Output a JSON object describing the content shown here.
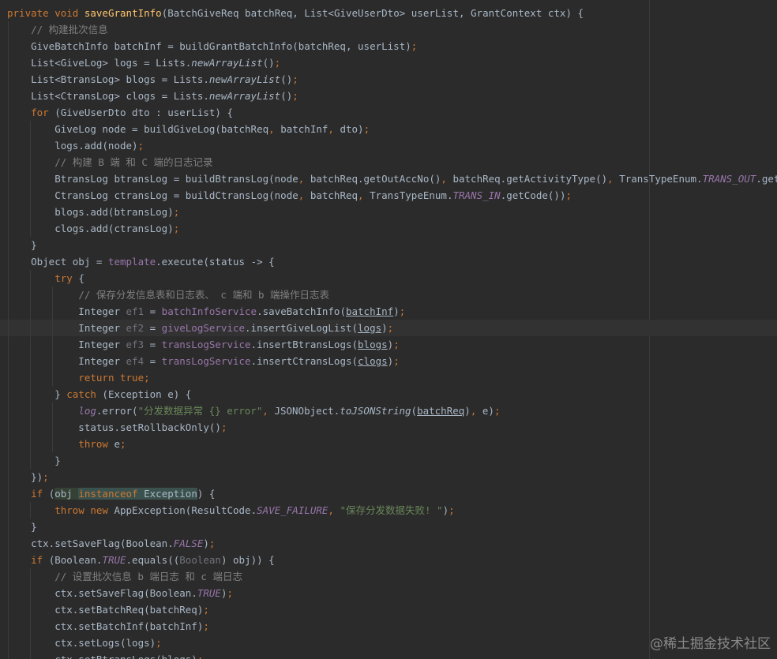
{
  "editor": {
    "language": "java",
    "theme": "darcula",
    "highlighted_line": 19,
    "watermark": "@稀土掘金技术社区"
  },
  "code": {
    "lines": [
      [
        {
          "t": "private ",
          "c": "kw"
        },
        {
          "t": "void ",
          "c": "kw"
        },
        {
          "t": "saveGrantInfo",
          "c": "fn"
        },
        {
          "t": "(BatchGiveReq batchReq, List<GiveUserDto> userList, GrantContext ctx) {"
        }
      ],
      [
        {
          "t": "    "
        },
        {
          "t": "// 构建批次信息",
          "c": "cm"
        }
      ],
      [
        {
          "t": "    GiveBatchInfo batchInf = buildGrantBatchInfo(batchReq, userList)"
        },
        {
          "t": ";",
          "c": "kw"
        }
      ],
      [
        {
          "t": "    List<GiveLog> logs = Lists."
        },
        {
          "t": "newArrayList",
          "c": "st-i"
        },
        {
          "t": "()"
        },
        {
          "t": ";",
          "c": "kw"
        }
      ],
      [
        {
          "t": "    List<BtransLog> blogs = Lists."
        },
        {
          "t": "newArrayList",
          "c": "st-i"
        },
        {
          "t": "()"
        },
        {
          "t": ";",
          "c": "kw"
        }
      ],
      [
        {
          "t": "    List<CtransLog> clogs = Lists."
        },
        {
          "t": "newArrayList",
          "c": "st-i"
        },
        {
          "t": "()"
        },
        {
          "t": ";",
          "c": "kw"
        }
      ],
      [
        {
          "t": "    "
        },
        {
          "t": "for ",
          "c": "kw"
        },
        {
          "t": "(GiveUserDto dto : userList) {"
        }
      ],
      [
        {
          "t": "        GiveLog node = buildGiveLog(batchReq"
        },
        {
          "t": ", ",
          "c": "kw"
        },
        {
          "t": "batchInf"
        },
        {
          "t": ", ",
          "c": "kw"
        },
        {
          "t": "dto)"
        },
        {
          "t": ";",
          "c": "kw"
        }
      ],
      [
        {
          "t": "        logs.add(node)"
        },
        {
          "t": ";",
          "c": "kw"
        }
      ],
      [
        {
          "t": "        "
        },
        {
          "t": "// 构建 B 端 和 C 端的日志记录",
          "c": "cm"
        }
      ],
      [
        {
          "t": "        BtransLog btransLog = buildBtransLog(node"
        },
        {
          "t": ", ",
          "c": "kw"
        },
        {
          "t": "batchReq.getOutAccNo()"
        },
        {
          "t": ", ",
          "c": "kw"
        },
        {
          "t": "batchReq.getActivityType()"
        },
        {
          "t": ", ",
          "c": "kw"
        },
        {
          "t": "TransTypeEnum."
        },
        {
          "t": "TRANS_OUT",
          "c": "fld-i"
        },
        {
          "t": ".getCode())"
        },
        {
          "t": ";",
          "c": "kw"
        }
      ],
      [
        {
          "t": "        CtransLog ctransLog = buildCtransLog(node"
        },
        {
          "t": ", ",
          "c": "kw"
        },
        {
          "t": "batchReq"
        },
        {
          "t": ", ",
          "c": "kw"
        },
        {
          "t": "TransTypeEnum."
        },
        {
          "t": "TRANS_IN",
          "c": "fld-i"
        },
        {
          "t": ".getCode())"
        },
        {
          "t": ";",
          "c": "kw"
        }
      ],
      [
        {
          "t": "        blogs.add(btransLog)"
        },
        {
          "t": ";",
          "c": "kw"
        }
      ],
      [
        {
          "t": "        clogs.add(ctransLog)"
        },
        {
          "t": ";",
          "c": "kw"
        }
      ],
      [
        {
          "t": "    }"
        }
      ],
      [
        {
          "t": "    Object obj = "
        },
        {
          "t": "template",
          "c": "fld"
        },
        {
          "t": ".execute(status -> {"
        }
      ],
      [
        {
          "t": "        "
        },
        {
          "t": "try ",
          "c": "kw"
        },
        {
          "t": "{"
        }
      ],
      [
        {
          "t": "            "
        },
        {
          "t": "// 保存分发信息表和日志表、 c 端和 b 端操作日志表",
          "c": "cm"
        }
      ],
      [
        {
          "t": "            Integer "
        },
        {
          "t": "ef1",
          "c": "unused"
        },
        {
          "t": " = "
        },
        {
          "t": "batchInfoService",
          "c": "fld"
        },
        {
          "t": ".saveBatchInfo("
        },
        {
          "t": "batchInf",
          "c": "ul"
        },
        {
          "t": ")"
        },
        {
          "t": ";",
          "c": "kw"
        }
      ],
      [
        {
          "t": "            Integer "
        },
        {
          "t": "ef2",
          "c": "unused"
        },
        {
          "t": " = "
        },
        {
          "t": "giveLogService",
          "c": "fld"
        },
        {
          "t": ".insertGiveLogList("
        },
        {
          "t": "logs",
          "c": "ul"
        },
        {
          "t": ")"
        },
        {
          "t": ";",
          "c": "kw"
        }
      ],
      [
        {
          "t": "            Integer "
        },
        {
          "t": "ef3",
          "c": "unused"
        },
        {
          "t": " = "
        },
        {
          "t": "transLogService",
          "c": "fld"
        },
        {
          "t": ".insertBtransLogs("
        },
        {
          "t": "blogs",
          "c": "ul"
        },
        {
          "t": ")"
        },
        {
          "t": ";",
          "c": "kw"
        }
      ],
      [
        {
          "t": "            Integer "
        },
        {
          "t": "ef4",
          "c": "unused"
        },
        {
          "t": " = "
        },
        {
          "t": "transLogService",
          "c": "fld"
        },
        {
          "t": ".insertCtransLogs("
        },
        {
          "t": "clogs",
          "c": "ul"
        },
        {
          "t": ")"
        },
        {
          "t": ";",
          "c": "kw"
        }
      ],
      [
        {
          "t": "            "
        },
        {
          "t": "return true;",
          "c": "kw"
        }
      ],
      [
        {
          "t": "        } "
        },
        {
          "t": "catch ",
          "c": "kw"
        },
        {
          "t": "(Exception e) {"
        }
      ],
      [
        {
          "t": "            "
        },
        {
          "t": "log",
          "c": "fld-i"
        },
        {
          "t": ".error("
        },
        {
          "t": "\"分发数据异常 {} error\"",
          "c": "str"
        },
        {
          "t": ", ",
          "c": "kw"
        },
        {
          "t": "JSONObject."
        },
        {
          "t": "toJSONString",
          "c": "st-i"
        },
        {
          "t": "("
        },
        {
          "t": "batchReq",
          "c": "ul"
        },
        {
          "t": ")"
        },
        {
          "t": ", ",
          "c": "kw"
        },
        {
          "t": "e)"
        },
        {
          "t": ";",
          "c": "kw"
        }
      ],
      [
        {
          "t": "            status.setRollbackOnly()"
        },
        {
          "t": ";",
          "c": "kw"
        }
      ],
      [
        {
          "t": "            "
        },
        {
          "t": "throw ",
          "c": "kw"
        },
        {
          "t": "e"
        },
        {
          "t": ";",
          "c": "kw"
        }
      ],
      [
        {
          "t": "        }"
        }
      ],
      [
        {
          "t": "    })"
        },
        {
          "t": ";",
          "c": "kw"
        }
      ],
      [
        {
          "t": "    "
        },
        {
          "t": "if ",
          "c": "kw"
        },
        {
          "t": "("
        },
        {
          "t": "obj ",
          "c": "hl-read"
        },
        {
          "t": "instanceof ",
          "c": "kw hl-brace"
        },
        {
          "t": "Exception",
          "c": "hl-brace"
        },
        {
          "t": ") {"
        }
      ],
      [
        {
          "t": "        "
        },
        {
          "t": "throw new ",
          "c": "kw"
        },
        {
          "t": "AppException(ResultCode."
        },
        {
          "t": "SAVE_FAILURE",
          "c": "fld-i"
        },
        {
          "t": ", ",
          "c": "kw"
        },
        {
          "t": "\"保存分发数据失败! \"",
          "c": "str"
        },
        {
          "t": ")"
        },
        {
          "t": ";",
          "c": "kw"
        }
      ],
      [
        {
          "t": "    }"
        }
      ],
      [
        {
          "t": "    ctx.setSaveFlag(Boolean."
        },
        {
          "t": "FALSE",
          "c": "fld-i"
        },
        {
          "t": ")"
        },
        {
          "t": ";",
          "c": "kw"
        }
      ],
      [
        {
          "t": "    "
        },
        {
          "t": "if ",
          "c": "kw"
        },
        {
          "t": "(Boolean."
        },
        {
          "t": "TRUE",
          "c": "fld-i"
        },
        {
          "t": ".equals(("
        },
        {
          "t": "Boolean",
          "c": "unused"
        },
        {
          "t": ") obj)) {"
        }
      ],
      [
        {
          "t": "        "
        },
        {
          "t": "// 设置批次信息 b 端日志 和 c 端日志",
          "c": "cm"
        }
      ],
      [
        {
          "t": "        ctx.setSaveFlag(Boolean."
        },
        {
          "t": "TRUE",
          "c": "fld-i"
        },
        {
          "t": ")"
        },
        {
          "t": ";",
          "c": "kw"
        }
      ],
      [
        {
          "t": "        ctx.setBatchReq(batchReq)"
        },
        {
          "t": ";",
          "c": "kw"
        }
      ],
      [
        {
          "t": "        ctx.setBatchInf(batchInf)"
        },
        {
          "t": ";",
          "c": "kw"
        }
      ],
      [
        {
          "t": "        ctx.setLogs(logs)"
        },
        {
          "t": ";",
          "c": "kw"
        }
      ],
      [
        {
          "t": "        ctx.setBtransLogs(blogs)"
        },
        {
          "t": ";",
          "c": "kw"
        }
      ]
    ]
  }
}
